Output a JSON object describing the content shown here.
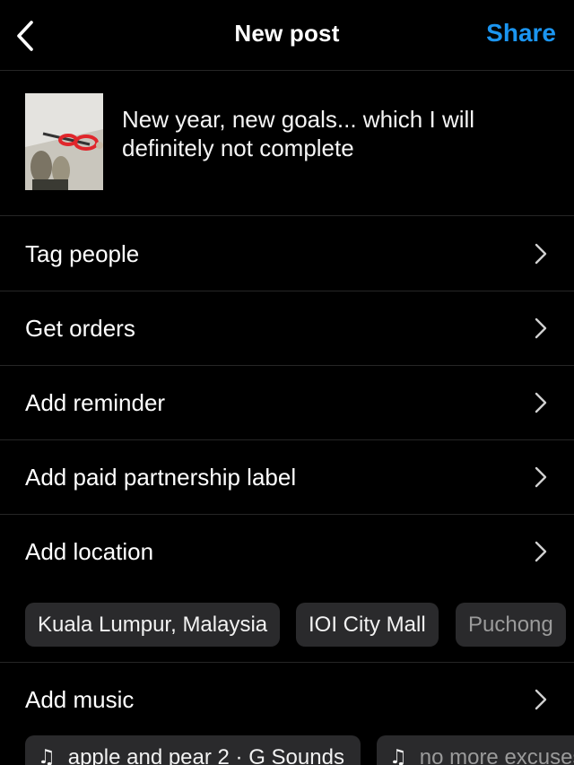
{
  "header": {
    "title": "New post",
    "share_label": "Share"
  },
  "post": {
    "caption": "New year, new goals... which I will definitely not complete"
  },
  "menu": {
    "tag_people": "Tag people",
    "get_orders": "Get orders",
    "add_reminder": "Add reminder",
    "paid_partnership": "Add paid partnership label",
    "add_location": "Add location",
    "add_music": "Add music"
  },
  "location_suggestions": [
    "Kuala Lumpur, Malaysia",
    "IOI City Mall",
    "Puchong"
  ],
  "music_suggestions": [
    "apple and pear 2 · G Sounds",
    "no more excuses"
  ],
  "colors": {
    "background": "#000000",
    "accent": "#1b95f0",
    "chip": "#2a2a2c",
    "divider": "#262626"
  }
}
